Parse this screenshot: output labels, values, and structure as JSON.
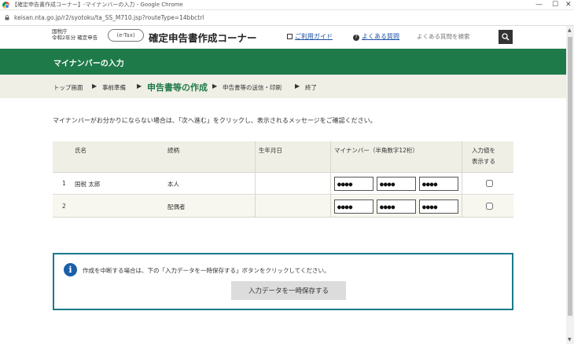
{
  "window": {
    "title": "【確定申告書作成コーナー】-マイナンバーの入力 - Google Chrome",
    "minimize": "—",
    "restore": "☐",
    "close": "✕"
  },
  "address_bar": {
    "url": "keisan.nta.go.jp/r2/syotoku/ta_SS_M710.jsp?routeType=14bbctrl"
  },
  "header": {
    "agency_line1": "国税庁",
    "agency_line2": "令和2年分 確定申告",
    "logo_text": "(e-Tax)",
    "site_title": "確定申告書作成コーナー",
    "guide_link": "ご利用ガイド",
    "faq_link": "よくある質問",
    "search_placeholder": "よくある質問を検索"
  },
  "page": {
    "title": "マイナンバーの入力"
  },
  "breadcrumb": {
    "items": [
      "トップ画面",
      "事前準備",
      "申告書等の作成",
      "申告書等の送信・印刷",
      "終了"
    ],
    "current_index": 2,
    "separator": "▶"
  },
  "instruction": "マイナンバーがお分かりにならない場合は、「次へ進む」をクリックし、表示されるメッセージをご確認ください。",
  "table": {
    "headers": {
      "name": "氏名",
      "relation": "続柄",
      "birth": "生年月日",
      "mynumber": "マイナンバー（半角数字12桁）",
      "show_line1": "入力値を",
      "show_line2": "表示する"
    },
    "rows": [
      {
        "no": "1",
        "name": "国税 太郎",
        "relation": "本人",
        "birth": "",
        "mn": [
          "●●●●",
          "●●●●",
          "●●●●"
        ]
      },
      {
        "no": "2",
        "name": "",
        "relation": "配偶者",
        "birth": "",
        "mn": [
          "●●●●",
          "●●●●",
          "●●●●"
        ]
      }
    ]
  },
  "info_box": {
    "text": "作成を中断する場合は、下の「入力データを一時保存する」ボタンをクリックしてください。",
    "save_button": "入力データを一時保存する"
  },
  "colors": {
    "brand_green": "#1f7a4a",
    "band_beige": "#f0efe6",
    "info_border": "#1a7a8a",
    "info_icon": "#1a5fa8"
  }
}
